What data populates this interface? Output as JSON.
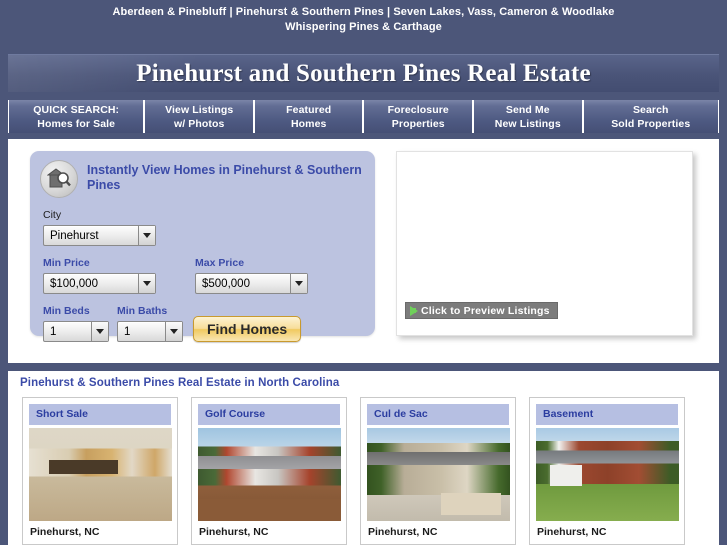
{
  "header": {
    "tagline_line1": "Aberdeen & Pinebluff | Pinehurst & Southern Pines | Seven Lakes, Vass, Cameron & Woodlake",
    "tagline_line2": "Whispering Pines & Carthage",
    "title": "Pinehurst and Southern Pines Real Estate"
  },
  "nav": {
    "tabs": [
      {
        "line1": "QUICK SEARCH:",
        "line2": "Homes for Sale"
      },
      {
        "line1": "View Listings",
        "line2": "w/ Photos"
      },
      {
        "line1": "Featured",
        "line2": "Homes"
      },
      {
        "line1": "Foreclosure",
        "line2": "Properties"
      },
      {
        "line1": "Send Me",
        "line2": "New Listings"
      },
      {
        "line1": "Search",
        "line2": "Sold Properties"
      }
    ]
  },
  "search": {
    "icon": "house-magnifier-icon",
    "heading": "Instantly View Homes in Pinehurst & Southern Pines",
    "city_label": "City",
    "city_value": "Pinehurst",
    "min_price_label": "Min Price",
    "min_price_value": "$100,000",
    "max_price_label": "Max Price",
    "max_price_value": "$500,000",
    "min_beds_label": "Min Beds",
    "min_beds_value": "1",
    "min_baths_label": "Min Baths",
    "min_baths_value": "1",
    "find_button": "Find Homes"
  },
  "preview": {
    "button_label": "Click to Preview Listings",
    "arrow_icon": "green-arrow-icon"
  },
  "listings": {
    "title": "Pinehurst & Southern Pines Real Estate in North Carolina",
    "cards": [
      {
        "tag": "Short Sale",
        "caption": "Pinehurst, NC",
        "photo": "ph-kitchen"
      },
      {
        "tag": "Golf Course",
        "caption": "Pinehurst, NC",
        "photo": "ph-ranch"
      },
      {
        "tag": "Cul de Sac",
        "caption": "Pinehurst, NC",
        "photo": "ph-stone"
      },
      {
        "tag": "Basement",
        "caption": "Pinehurst, NC",
        "photo": "ph-brick"
      }
    ]
  },
  "colors": {
    "page_background": "#4c5679",
    "banner": "#4a5478",
    "nav_tab": "#626d94",
    "search_panel": "#bcc3e0",
    "accent_blue": "#3b4ba8",
    "find_button": "#f0c95f",
    "preview_button": "#7c7c7c",
    "green_arrow": "#6fd05a",
    "card_tag": "#b6bfe2"
  }
}
